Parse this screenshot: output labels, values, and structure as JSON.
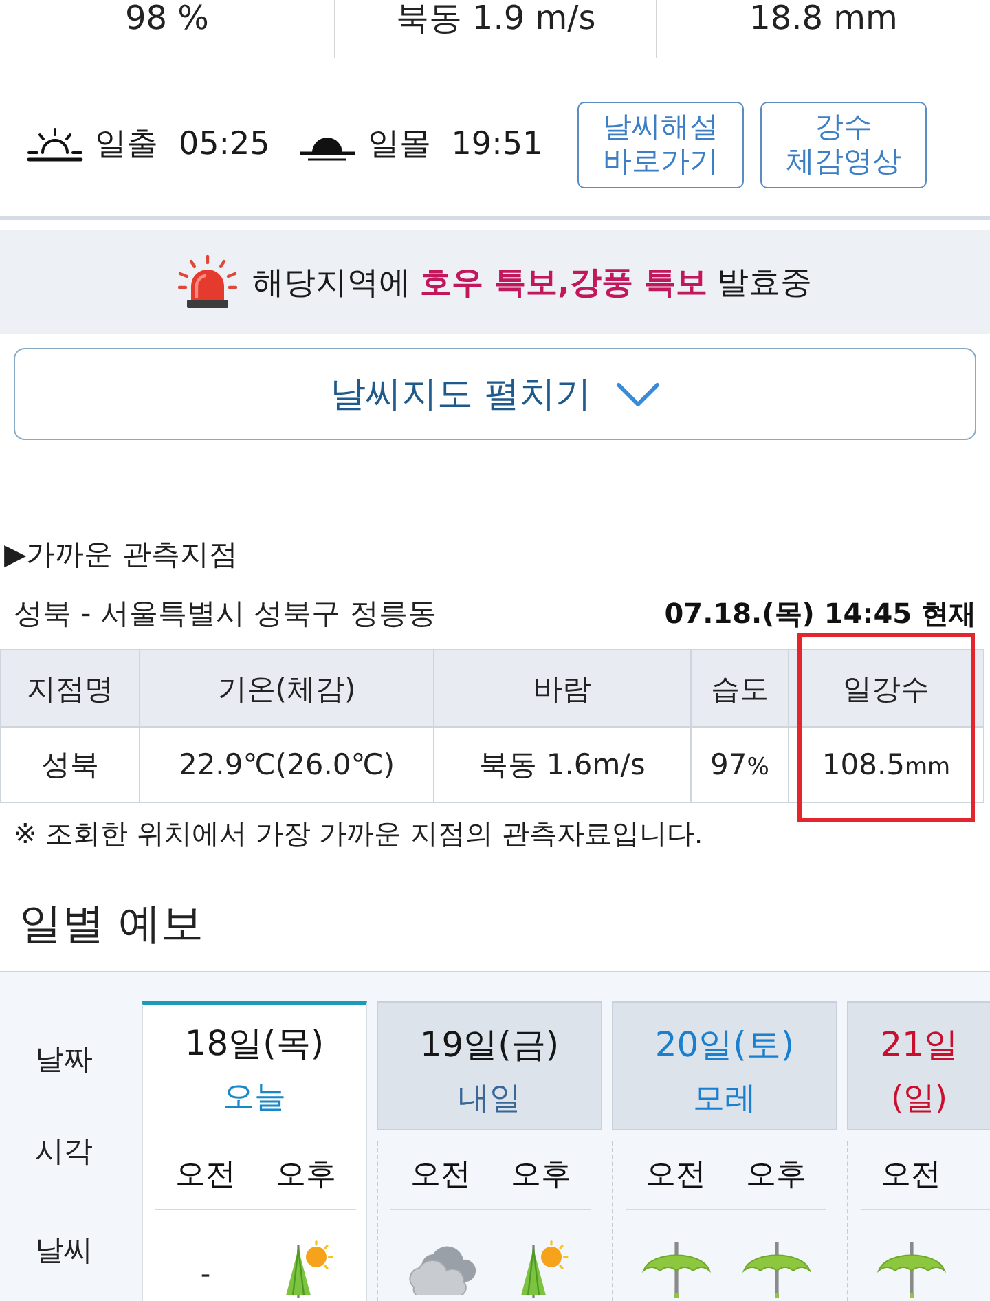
{
  "summary": [
    {
      "value": "98 %"
    },
    {
      "value": "북동 1.9 m/s"
    },
    {
      "value": "18.8 mm"
    }
  ],
  "sun": [
    {
      "kind": "sunrise",
      "label": "일출",
      "time": "05:25"
    },
    {
      "kind": "sunset",
      "label": "일몰",
      "time": "19:51"
    }
  ],
  "links": [
    {
      "lines": [
        "날씨해설",
        "바로가기"
      ]
    },
    {
      "lines": [
        "강수",
        "체감영상"
      ]
    }
  ],
  "alert": {
    "text": "해당지역에 **호우 특보,강풍 특보** 발효중"
  },
  "map_toggle": {
    "label": "날씨지도 펼치기",
    "expanded": false
  },
  "nearby": {
    "title": "▶가까운 관측지점",
    "location": "성북 - 서울특별시 성북구 정릉동",
    "timestamp": "07.18.(목) 14:45 현재",
    "table": {
      "columns": [
        {
          "label": "지점명",
          "highlighted": false
        },
        {
          "label": "기온(체감)",
          "highlighted": false
        },
        {
          "label": "바람",
          "highlighted": false
        },
        {
          "label": "습도",
          "highlighted": false
        },
        {
          "label": "일강수",
          "highlighted": true
        }
      ],
      "rows": [
        [
          {
            "text": "성북"
          },
          {
            "text": "22.9℃(26.0℃)"
          },
          {
            "text": "북동 1.6m/s"
          },
          {
            "text": "97",
            "unit": "%"
          },
          {
            "text": "108.5",
            "unit": "mm"
          }
        ]
      ]
    },
    "note": "※ 조회한 위치에서 가장 가까운 지점의 관측자료입니다."
  },
  "forecast": {
    "title": "일별 예보",
    "row_labels": [
      "날짜",
      "시각",
      "날씨"
    ],
    "days": [
      {
        "date": "18일(목)",
        "sub": "오늘",
        "kind": "weekday",
        "selected": true,
        "periods": [
          {
            "label": "오전",
            "weather": {
              "kind": "none",
              "text": "-"
            }
          },
          {
            "label": "오후",
            "weather": {
              "kind": "rain-sun"
            }
          }
        ]
      },
      {
        "date": "19일(금)",
        "sub": "내일",
        "kind": "weekday",
        "selected": false,
        "periods": [
          {
            "label": "오전",
            "weather": {
              "kind": "cloudy"
            }
          },
          {
            "label": "오후",
            "weather": {
              "kind": "rain-sun"
            }
          }
        ]
      },
      {
        "date": "20일(토)",
        "sub": "모레",
        "kind": "saturday",
        "selected": false,
        "periods": [
          {
            "label": "오전",
            "weather": {
              "kind": "rain"
            }
          },
          {
            "label": "오후",
            "weather": {
              "kind": "rain"
            }
          }
        ]
      },
      {
        "date": "21일",
        "sub": "(일)",
        "kind": "sunday",
        "selected": false,
        "periods": [
          {
            "label": "오전",
            "weather": {
              "kind": "rain"
            }
          }
        ]
      }
    ]
  }
}
